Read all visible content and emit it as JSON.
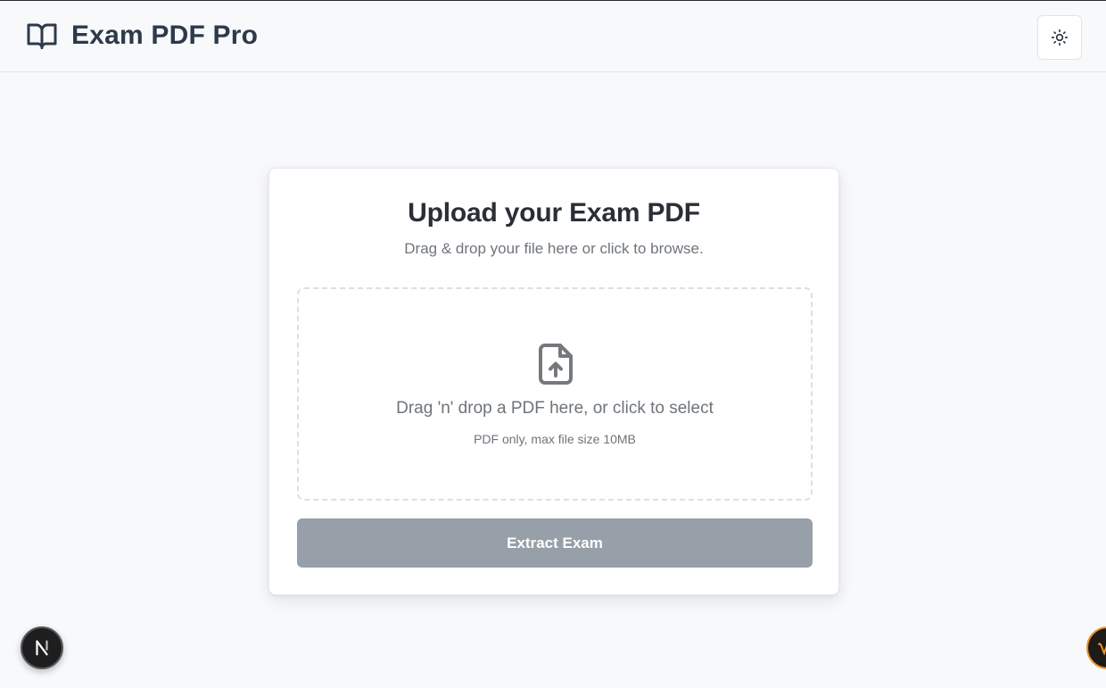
{
  "app": {
    "title": "Exam PDF Pro",
    "logo_icon": "book-open-icon",
    "theme_toggle_icon": "sun-icon"
  },
  "upload_card": {
    "title": "Upload your Exam PDF",
    "subtitle": "Drag & drop your file here or click to browse.",
    "dropzone": {
      "icon": "file-upload-icon",
      "text": "Drag 'n' drop a PDF here, or click to select",
      "hint": "PDF only, max file size 10MB"
    },
    "submit_label": "Extract Exam"
  },
  "floating": {
    "dev_badge_letter": "N",
    "dev_badge_icon": "nextjs-logo-icon",
    "assistant_icon": "assistant-badge-icon"
  },
  "colors": {
    "background": "#f8f9fb",
    "heading": "#2c3a4b",
    "button_disabled": "#979fa8",
    "assistant_ring": "#e8922c"
  }
}
